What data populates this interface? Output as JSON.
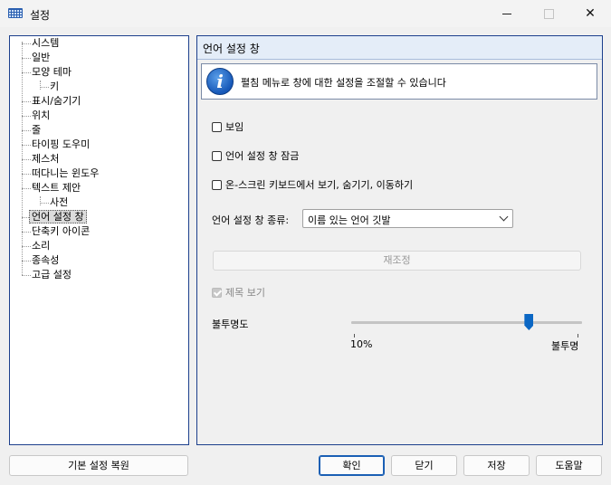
{
  "window": {
    "title": "설정",
    "icon": "keyboard-icon"
  },
  "tree": {
    "items": [
      {
        "label": "시스템",
        "level": 0
      },
      {
        "label": "일반",
        "level": 0
      },
      {
        "label": "모양 테마",
        "level": 0
      },
      {
        "label": "키",
        "level": 1
      },
      {
        "label": "표시/숨기기",
        "level": 0
      },
      {
        "label": "위치",
        "level": 0
      },
      {
        "label": "줄",
        "level": 0
      },
      {
        "label": "타이핑 도우미",
        "level": 0
      },
      {
        "label": "제스처",
        "level": 0
      },
      {
        "label": "떠다니는 윈도우",
        "level": 0
      },
      {
        "label": "텍스트 제안",
        "level": 0
      },
      {
        "label": "사전",
        "level": 1
      },
      {
        "label": "언어 설정 창",
        "level": 0,
        "selected": true
      },
      {
        "label": "단축키 아이콘",
        "level": 0
      },
      {
        "label": "소리",
        "level": 0
      },
      {
        "label": "종속성",
        "level": 0
      },
      {
        "label": "고급 설정",
        "level": 0
      }
    ]
  },
  "panel": {
    "title": "언어 설정 창",
    "info_icon": "info-icon",
    "info_text": "펼침 메뉴로 창에 대한 설정을 조절할 수 있습니다",
    "checkboxes": [
      {
        "label": "보임",
        "checked": false
      },
      {
        "label": "언어 설정 창 잠금",
        "checked": false
      },
      {
        "label": "온-스크린 키보드에서 보기, 숨기기, 이동하기",
        "checked": false
      }
    ],
    "combo_label": "언어 설정 창 종류:",
    "combo_value": "이름 있는 언어 깃발",
    "reset_button": "재조정",
    "title_checkbox": {
      "label": "제목 보기",
      "checked": true,
      "disabled": true
    },
    "opacity": {
      "label": "불투명도",
      "min_label": "10%",
      "max_label": "불투명",
      "value_fraction": 0.77
    }
  },
  "footer": {
    "restore_defaults": "기본 설정 복원",
    "ok": "확인",
    "close": "닫기",
    "save": "저장",
    "help": "도움말"
  },
  "colors": {
    "accent": "#0b67c4",
    "border": "#1c3f8c",
    "header_bg": "#e4edf8"
  }
}
